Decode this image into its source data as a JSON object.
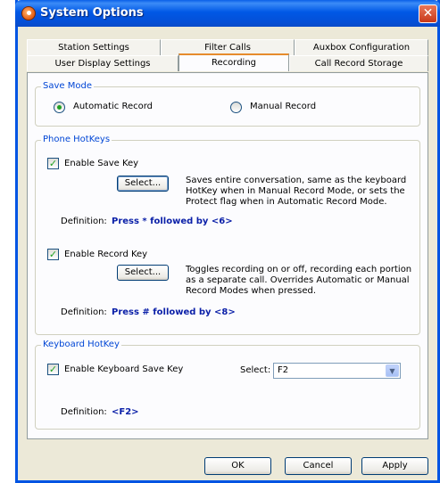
{
  "window": {
    "title": "System Options",
    "close_glyph": "✕"
  },
  "tabs": {
    "row1": [
      "Station Settings",
      "Filter Calls",
      "Auxbox Configuration"
    ],
    "row2": [
      "User Display Settings",
      "Recording",
      "Call Record Storage"
    ],
    "active": "Recording"
  },
  "save_mode": {
    "title": "Save Mode",
    "automatic_label": "Automatic Record",
    "manual_label": "Manual Record",
    "selected": "Automatic Record"
  },
  "phone_hotkeys": {
    "title": "Phone HotKeys",
    "save_key": {
      "label": "Enable Save Key",
      "checked": true,
      "button": "Select...",
      "description": "Saves entire conversation, same as the keyboard HotKey when in Manual Record Mode, or sets the Protect flag when in Automatic Record Mode.",
      "definition_label": "Definition:",
      "definition_value": "Press * followed by <6>"
    },
    "record_key": {
      "label": "Enable Record Key",
      "checked": true,
      "button": "Select...",
      "description": "Toggles recording on or off, recording each portion as a separate call. Overrides Automatic or Manual Record Modes when pressed.",
      "definition_label": "Definition:",
      "definition_value": "Press # followed by <8>"
    }
  },
  "keyboard_hotkey": {
    "title": "Keyboard HotKey",
    "label": "Enable Keyboard Save Key",
    "checked": true,
    "select_label": "Select:",
    "select_value": "F2",
    "definition_label": "Definition:",
    "definition_value": "<F2>"
  },
  "footer": {
    "ok": "OK",
    "cancel": "Cancel",
    "apply": "Apply"
  },
  "colors": {
    "titlebar": "#0058e6",
    "group_title": "#0046d5",
    "definition_value": "#0a1fa8",
    "check_mark": "#21a121"
  }
}
